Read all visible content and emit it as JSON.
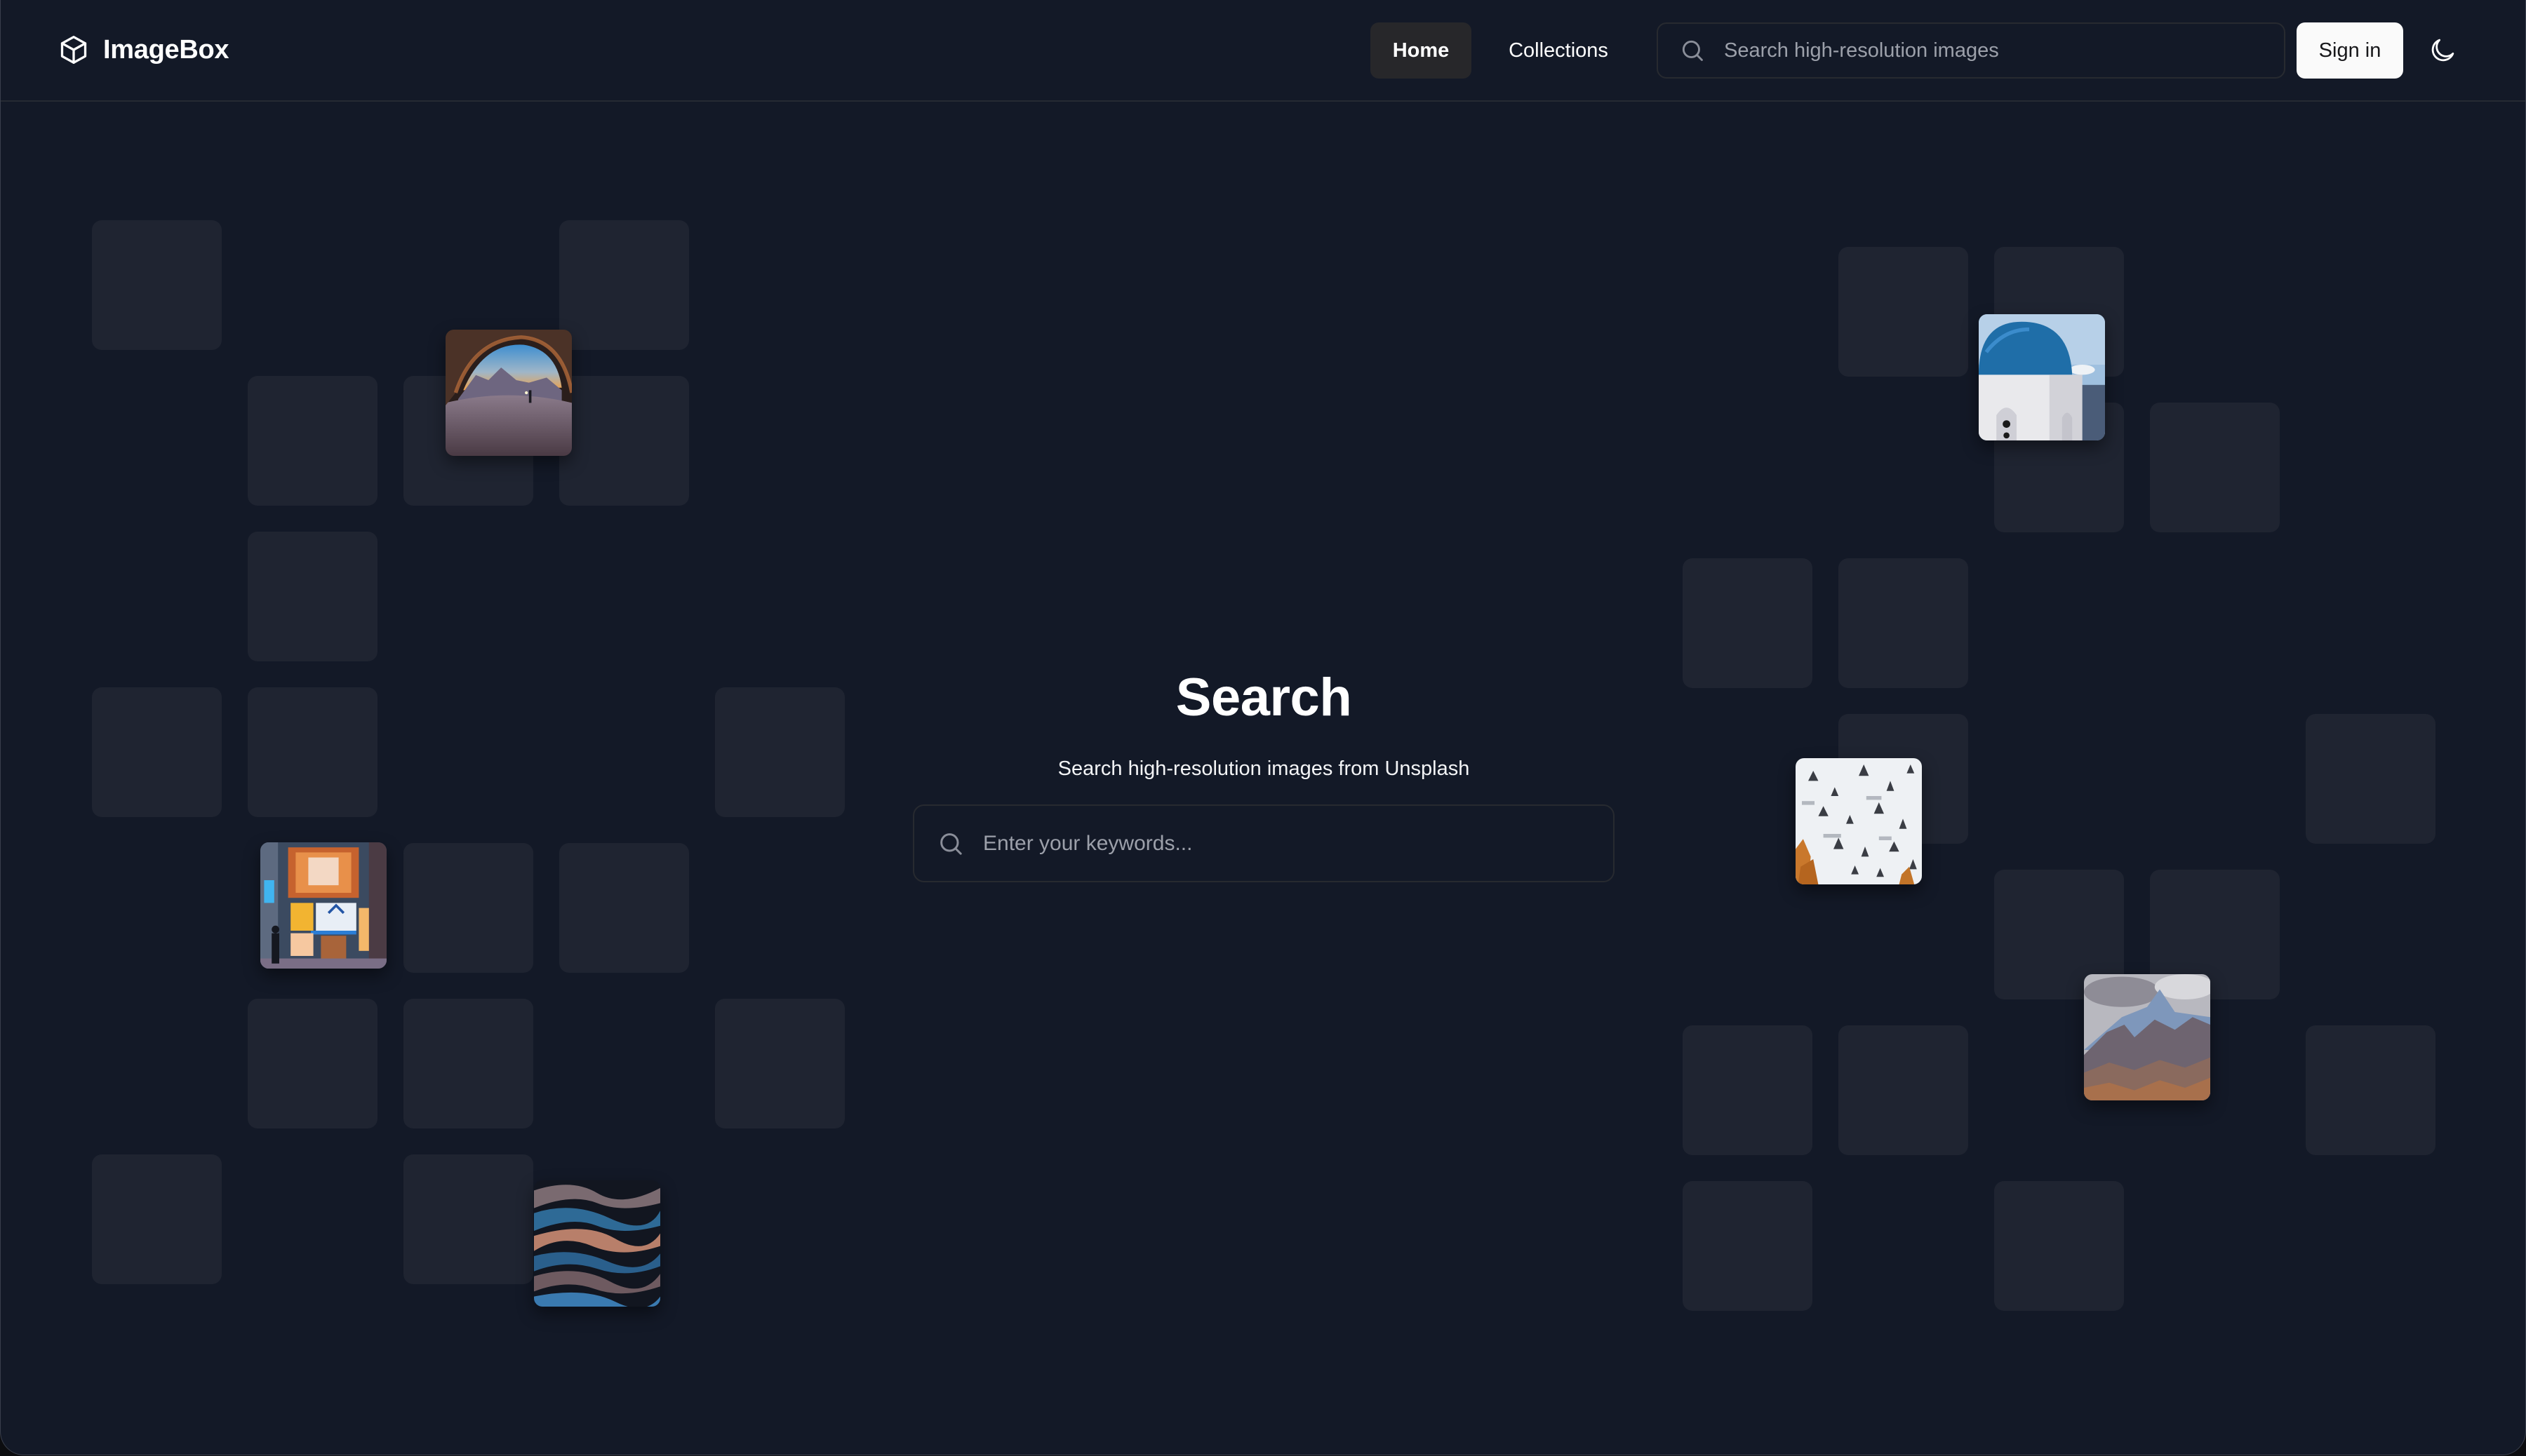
{
  "app": {
    "name": "ImageBox",
    "logo_icon": "cube-icon"
  },
  "header": {
    "nav": [
      {
        "label": "Home",
        "active": true
      },
      {
        "label": "Collections",
        "active": false
      }
    ],
    "search": {
      "placeholder": "Search high-resolution images",
      "value": "",
      "icon": "search-icon"
    },
    "signin_label": "Sign in",
    "theme_toggle_icon": "moon-icon"
  },
  "hero": {
    "title": "Search",
    "subtitle": "Search high-resolution images from Unsplash",
    "search": {
      "placeholder": "Enter your keywords...",
      "value": "",
      "icon": "search-icon"
    }
  },
  "gallery": {
    "photos": [
      {
        "subject": "cave-arch-sunset"
      },
      {
        "subject": "santorini-blue-dome"
      },
      {
        "subject": "snowy-forest-aerial"
      },
      {
        "subject": "night-street-storefront"
      },
      {
        "subject": "abstract-waves"
      },
      {
        "subject": "rocky-mountains"
      }
    ]
  },
  "colors": {
    "background": "#131927",
    "tile": "#1f2431",
    "nav_active_bg": "#27272a",
    "signin_bg": "#fafafa",
    "text_primary": "#ffffff",
    "text_muted": "#9ca0aa"
  }
}
